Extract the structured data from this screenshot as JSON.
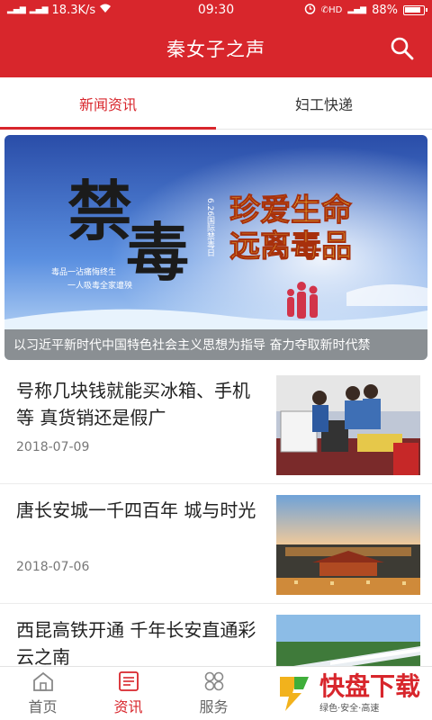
{
  "status_bar": {
    "network": "18.3K/s",
    "time": "09:30",
    "battery": "88%",
    "volte": "HD"
  },
  "header": {
    "title": "秦女子之声",
    "search_icon": "search-icon"
  },
  "tabs": [
    {
      "label": "新闻资讯",
      "active": true
    },
    {
      "label": "妇工快递",
      "active": false
    }
  ],
  "banner": {
    "caption": "以习近平新时代中国特色社会主义思想为指导 奋力夺取新时代禁",
    "big_text": "禁毒",
    "slogan_line1": "珍爱生命",
    "slogan_line2": "远离毒品",
    "small_line1": "毒品一沾痛悔终生",
    "small_line2": "一人吸毒全家遭殃",
    "vertical_text": "6.26国际禁毒日"
  },
  "news": [
    {
      "title": "号称几块钱就能买冰箱、手机等 真货销还是假广",
      "date": "2018-07-09"
    },
    {
      "title": "唐长安城一千四百年 城与时光",
      "date": "2018-07-06"
    },
    {
      "title": "西昆高铁开通 千年长安直通彩云之南",
      "date": ""
    }
  ],
  "bottom_nav": [
    {
      "label": "首页",
      "icon": "home-icon",
      "active": false
    },
    {
      "label": "资讯",
      "icon": "news-icon",
      "active": true
    },
    {
      "label": "服务",
      "icon": "grid-icon",
      "active": false
    }
  ],
  "watermark": {
    "brand": "快盘下载",
    "sub": "绿色·安全·高速"
  },
  "colors": {
    "brand_red": "#d8262c"
  }
}
